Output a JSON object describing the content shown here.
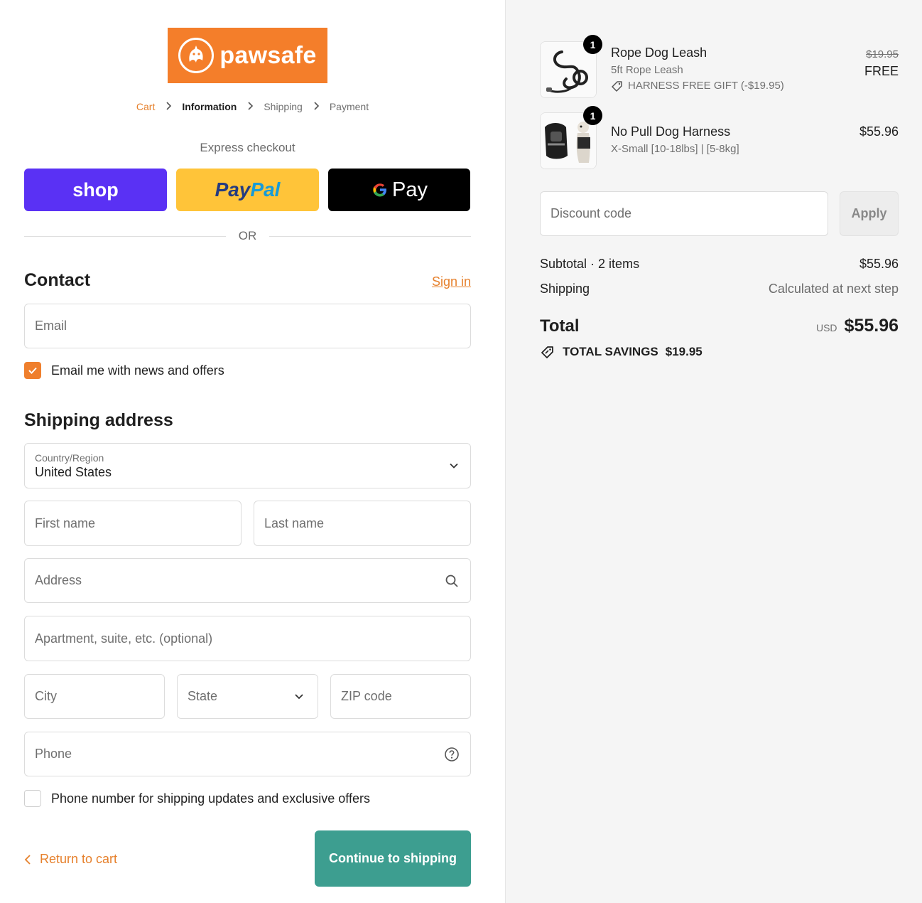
{
  "brand": {
    "name": "pawsafe",
    "logo_bg": "#f47e2a"
  },
  "breadcrumbs": [
    {
      "label": "Cart",
      "state": "link"
    },
    {
      "label": "Information",
      "state": "current"
    },
    {
      "label": "Shipping",
      "state": "upcoming"
    },
    {
      "label": "Payment",
      "state": "upcoming"
    }
  ],
  "express": {
    "title": "Express checkout",
    "shop_label": "shop",
    "paypal_part1": "Pay",
    "paypal_part2": "Pal",
    "gpay_label": "Pay",
    "or_label": "OR"
  },
  "contact": {
    "title": "Contact",
    "signin_label": "Sign in",
    "email_placeholder": "Email",
    "newsletter_label": "Email me with news and offers",
    "newsletter_checked": true
  },
  "shipping": {
    "title": "Shipping address",
    "country_label": "Country/Region",
    "country_value": "United States",
    "first_name": "First name",
    "last_name": "Last name",
    "address": "Address",
    "apartment": "Apartment, suite, etc. (optional)",
    "city": "City",
    "state": "State",
    "zip": "ZIP code",
    "phone": "Phone",
    "sms_label": "Phone number for shipping updates and exclusive offers"
  },
  "actions": {
    "return_label": "Return to cart",
    "continue_label": "Continue to shipping",
    "accent": "#3d9e90"
  },
  "cart": {
    "items": [
      {
        "qty": "1",
        "name": "Rope Dog Leash",
        "variant": "5ft Rope Leash",
        "gift": "HARNESS FREE GIFT (-$19.95)",
        "old_price": "$19.95",
        "price": "FREE"
      },
      {
        "qty": "1",
        "name": "No Pull Dog Harness",
        "variant": "X-Small [10-18lbs] | [5-8kg]",
        "price": "$55.96"
      }
    ],
    "discount_placeholder": "Discount code",
    "apply_label": "Apply",
    "subtotal_label": "Subtotal · 2 items",
    "subtotal_value": "$55.96",
    "shipping_label": "Shipping",
    "shipping_value": "Calculated at next step",
    "total_label": "Total",
    "currency": "USD",
    "total_value": "$55.96",
    "savings_label": "TOTAL SAVINGS",
    "savings_value": "$19.95"
  }
}
